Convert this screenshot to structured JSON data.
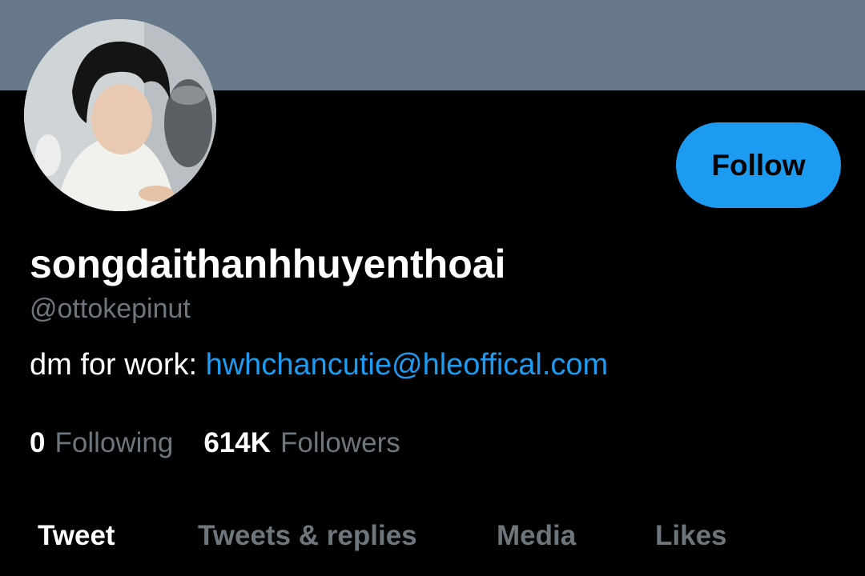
{
  "profile": {
    "display_name": "songdaithanhhuyenthoai",
    "handle": "@ottokepinut",
    "bio_prefix": "dm for work: ",
    "bio_link": "hwhchancutie@hleoffical.com",
    "follow_label": "Follow"
  },
  "stats": {
    "following_count": "0",
    "following_label": "Following",
    "followers_count": "614K",
    "followers_label": "Followers"
  },
  "tabs": [
    {
      "label": "Tweet",
      "active": true
    },
    {
      "label": "Tweets & replies",
      "active": false
    },
    {
      "label": "Media",
      "active": false
    },
    {
      "label": "Likes",
      "active": false
    }
  ],
  "colors": {
    "banner": "#66788a",
    "accent": "#1d9bf0",
    "background": "#000000",
    "muted_text": "#6e767d"
  }
}
